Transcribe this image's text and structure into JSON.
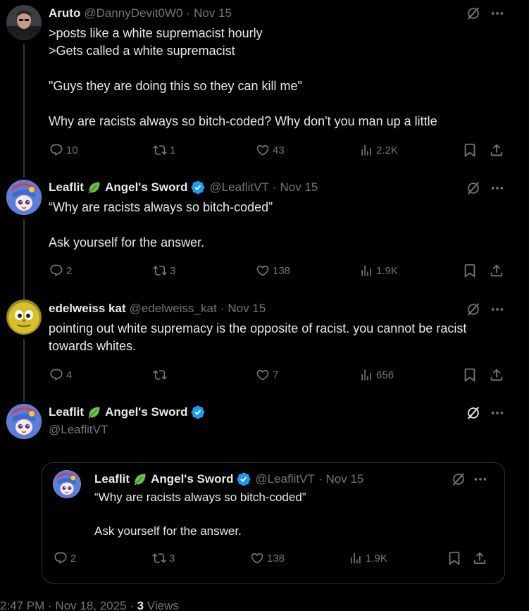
{
  "tweets": [
    {
      "name": "Aruto",
      "handle": "@DannyDevit0W0",
      "date": "Nov 15",
      "text": ">posts like a white supremacist hourly\n>Gets called a white supremacist\n\n\"Guys they are doing this so they can kill me\"\n\nWhy are racists always so bitch-coded? Why don't you man up a little",
      "replies": "10",
      "retweets": "1",
      "likes": "43",
      "views": "2.2K"
    },
    {
      "name_a": "Leaflit",
      "name_b": "Angel's Sword",
      "handle": "@LeaflitVT",
      "date": "Nov 15",
      "text": "“Why are racists always so bitch-coded”\n\nAsk yourself for the answer.",
      "replies": "2",
      "retweets": "3",
      "likes": "138",
      "views": "1.9K"
    },
    {
      "name": "edelweiss kat",
      "handle": "@edelweiss_kat",
      "date": "Nov 15",
      "text": "pointing out white supremacy is the opposite of racist. you cannot be racist towards whites.",
      "replies": "4",
      "retweets": "",
      "likes": "7",
      "views": "656"
    },
    {
      "name_a": "Leaflit",
      "name_b": "Angel's Sword",
      "handle": "@LeaflitVT"
    }
  ],
  "quote": {
    "name_a": "Leaflit",
    "name_b": "Angel's Sword",
    "handle": "@LeaflitVT",
    "date": "Nov 15",
    "text": "“Why are racists always so bitch-coded”\n\nAsk yourself for the answer.",
    "replies": "2",
    "retweets": "3",
    "likes": "138",
    "views": "1.9K"
  },
  "footer": {
    "time": "2:47 PM · Nov 18, 2025 · ",
    "views_count": "3",
    "views_label": " Views"
  },
  "colors": {
    "background": "#000000",
    "text": "#e7e9ea",
    "muted": "#71767b",
    "verified": "#1d9bf0",
    "leaf": "#6fbf4a"
  }
}
